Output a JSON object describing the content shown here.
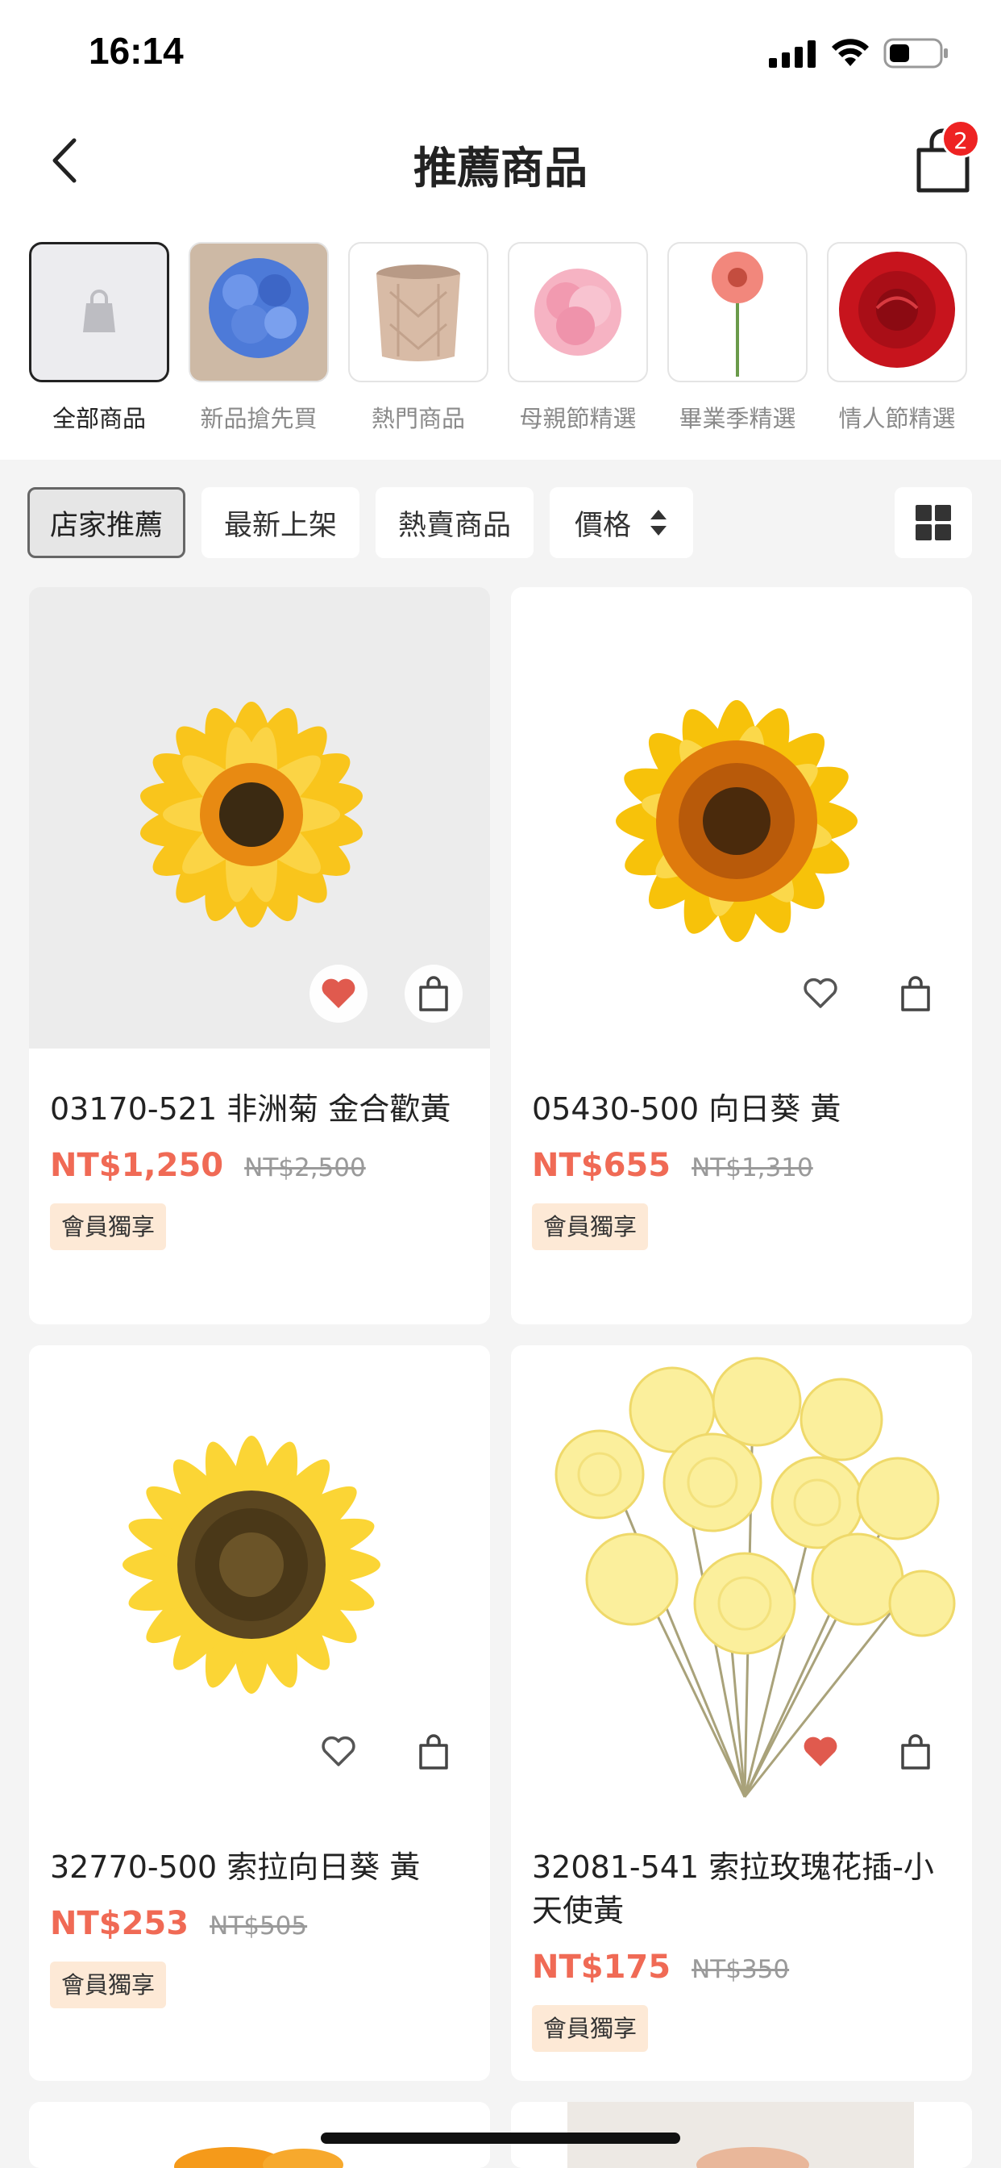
{
  "status_bar": {
    "time": "16:14"
  },
  "nav": {
    "title": "推薦商品",
    "cart_count": "2"
  },
  "categories": [
    {
      "label": "全部商品",
      "active": true
    },
    {
      "label": "新品搶先買",
      "active": false
    },
    {
      "label": "熱門商品",
      "active": false
    },
    {
      "label": "母親節精選",
      "active": false
    },
    {
      "label": "畢業季精選",
      "active": false
    },
    {
      "label": "情人節精選",
      "active": false
    }
  ],
  "filters": {
    "store_pick": "店家推薦",
    "newest": "最新上架",
    "best_selling": "熱賣商品",
    "price": "價格"
  },
  "products": [
    {
      "name": "03170-521 非洲菊 金合歡黃",
      "price": "NT$1,250",
      "original_price": "NT$2,500",
      "tag": "會員獨享",
      "favorited": true
    },
    {
      "name": "05430-500 向日葵 黃",
      "price": "NT$655",
      "original_price": "NT$1,310",
      "tag": "會員獨享",
      "favorited": false
    },
    {
      "name": "32770-500 索拉向日葵 黃",
      "price": "NT$253",
      "original_price": "NT$505",
      "tag": "會員獨享",
      "favorited": false
    },
    {
      "name": "32081-541 索拉玫瑰花插-小 天使黃",
      "price": "NT$175",
      "original_price": "NT$350",
      "tag": "會員獨享",
      "favorited": true
    }
  ],
  "colors": {
    "price": "#f06a55",
    "member_tag_bg": "#fde9d6",
    "favorite_heart": "#e05a4e",
    "badge": "#ee2222"
  }
}
